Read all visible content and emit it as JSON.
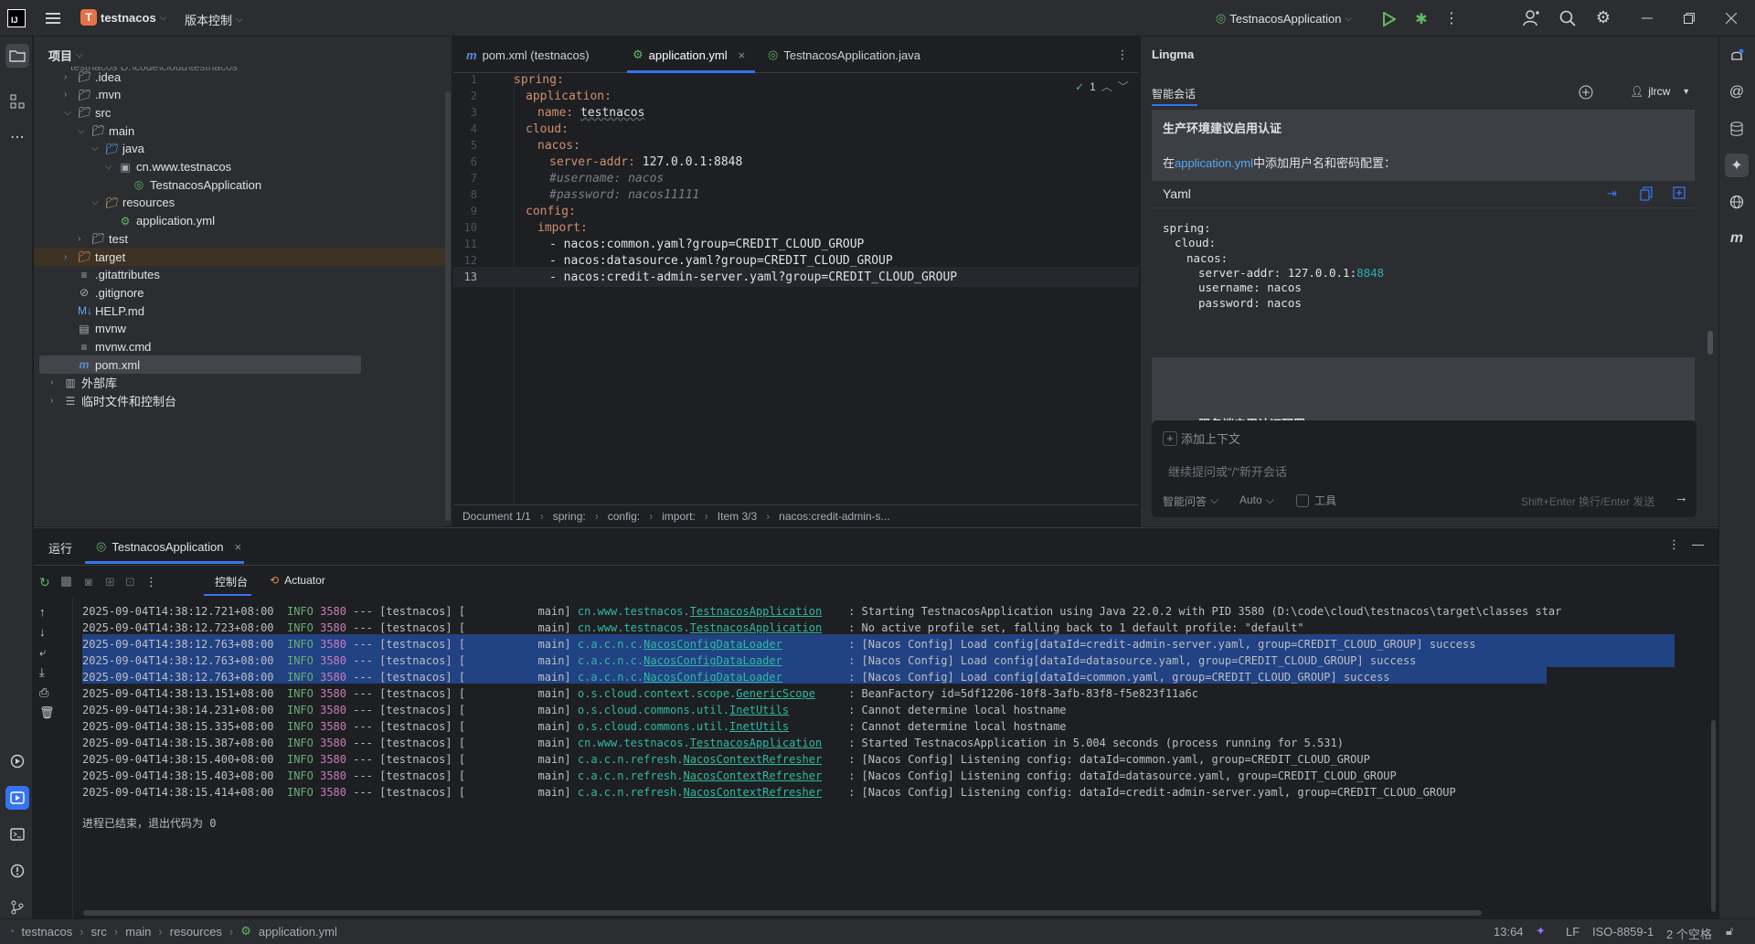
{
  "titlebar": {
    "project_initial": "T",
    "project_name": "testnacos",
    "vcs_menu": "版本控制",
    "run_config": "TestnacosApplication"
  },
  "project_panel": {
    "title": "项目",
    "tree": [
      {
        "label": ".idea",
        "indent": 1,
        "type": "folder",
        "expanded": false
      },
      {
        "label": ".mvn",
        "indent": 1,
        "type": "folder",
        "expanded": false
      },
      {
        "label": "src",
        "indent": 1,
        "type": "folder",
        "expanded": true
      },
      {
        "label": "main",
        "indent": 2,
        "type": "folder",
        "expanded": true
      },
      {
        "label": "java",
        "indent": 3,
        "type": "src-folder",
        "expanded": true
      },
      {
        "label": "cn.www.testnacos",
        "indent": 4,
        "type": "package",
        "expanded": true
      },
      {
        "label": "TestnacosApplication",
        "indent": 5,
        "type": "spring-class"
      },
      {
        "label": "resources",
        "indent": 3,
        "type": "res-folder",
        "expanded": true
      },
      {
        "label": "application.yml",
        "indent": 4,
        "type": "yml"
      },
      {
        "label": "test",
        "indent": 2,
        "type": "folder",
        "expanded": false
      },
      {
        "label": "target",
        "indent": 1,
        "type": "target-folder",
        "expanded": false
      },
      {
        "label": ".gitattributes",
        "indent": 1,
        "type": "file"
      },
      {
        "label": ".gitignore",
        "indent": 1,
        "type": "ignore"
      },
      {
        "label": "HELP.md",
        "indent": 1,
        "type": "md"
      },
      {
        "label": "mvnw",
        "indent": 1,
        "type": "script"
      },
      {
        "label": "mvnw.cmd",
        "indent": 1,
        "type": "file"
      },
      {
        "label": "pom.xml",
        "indent": 1,
        "type": "maven"
      },
      {
        "label": "外部库",
        "indent": 0,
        "type": "lib",
        "expanded": false
      },
      {
        "label": "临时文件和控制台",
        "indent": 0,
        "type": "scratch",
        "expanded": false
      }
    ]
  },
  "editor": {
    "tabs": [
      {
        "label": "pom.xml (testnacos)",
        "icon": "maven-icon",
        "active": false
      },
      {
        "label": "application.yml",
        "icon": "yml-icon",
        "active": true
      },
      {
        "label": "TestnacosApplication.java",
        "icon": "spring-class-icon",
        "active": false
      }
    ],
    "inspection_count": "1",
    "lines": [
      {
        "n": "1",
        "i": 0,
        "k": "spring:",
        "v": "",
        "c": ""
      },
      {
        "n": "2",
        "i": 1,
        "k": "application:",
        "v": "",
        "c": ""
      },
      {
        "n": "3",
        "i": 2,
        "k": "name: ",
        "v": "testnacos",
        "c": ""
      },
      {
        "n": "4",
        "i": 1,
        "k": "cloud:",
        "v": "",
        "c": ""
      },
      {
        "n": "5",
        "i": 2,
        "k": "nacos:",
        "v": "",
        "c": ""
      },
      {
        "n": "6",
        "i": 3,
        "k": "server-addr: ",
        "v": "127.0.0.1:8848",
        "c": ""
      },
      {
        "n": "7",
        "i": 3,
        "k": "",
        "v": "",
        "c": "#username: nacos"
      },
      {
        "n": "8",
        "i": 3,
        "k": "",
        "v": "",
        "c": "#password: nacos11111"
      },
      {
        "n": "9",
        "i": 1,
        "k": "config:",
        "v": "",
        "c": ""
      },
      {
        "n": "10",
        "i": 2,
        "k": "import:",
        "v": "",
        "c": ""
      },
      {
        "n": "11",
        "i": 3,
        "k": "",
        "v": "- nacos:common.yaml?group=CREDIT_CLOUD_GROUP",
        "c": ""
      },
      {
        "n": "12",
        "i": 3,
        "k": "",
        "v": "- nacos:datasource.yaml?group=CREDIT_CLOUD_GROUP",
        "c": ""
      },
      {
        "n": "13",
        "i": 3,
        "k": "",
        "v": "- nacos:credit-admin-server.yaml?group=CREDIT_CLOUD_GROUP",
        "c": ""
      }
    ],
    "breadcrumb": [
      "Document 1/1",
      "spring:",
      "config:",
      "import:",
      "Item 3/3",
      "nacos:credit-admin-s..."
    ]
  },
  "lingma": {
    "title": "Lingma",
    "tab": "智能会话",
    "user": "jlrcw",
    "heading1": "生产环境建议启用认证",
    "para_prefix": "在",
    "para_link": "application.yml",
    "para_suffix": "中添加用户名和密码配置：",
    "code_lang": "Yaml",
    "code": [
      {
        "i": 0,
        "k": "spring:",
        "v": ""
      },
      {
        "i": 1,
        "k": "cloud:",
        "v": ""
      },
      {
        "i": 2,
        "k": "nacos:",
        "v": ""
      },
      {
        "i": 3,
        "k": "server-addr: 127.0.0.1:",
        "v": "8848"
      },
      {
        "i": 3,
        "k": "username: nacos",
        "v": ""
      },
      {
        "i": 3,
        "k": "password: nacos",
        "v": ""
      }
    ],
    "heading2": "Nacos服务端启用认证配置",
    "add_context": "添加上下文",
    "input_placeholder": "继续提问或\"/\"新开会话",
    "mode": "智能问答",
    "model": "Auto",
    "tools": "工具",
    "send_hint": "Shift+Enter 换行/Enter 发送"
  },
  "run_panel": {
    "title": "运行",
    "tab": "TestnacosApplication",
    "console_tab": "控制台",
    "actuator_tab": "Actuator",
    "logs": [
      {
        "ts": "2025-09-04T14:38:12.721+08:00",
        "lvl": "INFO",
        "pid": "3580",
        "mid": " --- [testnacos] [           main] ",
        "pkg": "cn.www.testnacos.",
        "cls": "TestnacosApplication",
        "pad": "    ",
        "msg": ": Starting TestnacosApplication using Java 22.0.2 with PID 3580 (D:\\code\\cloud\\testnacos\\target\\classes star",
        "sel": false
      },
      {
        "ts": "2025-09-04T14:38:12.723+08:00",
        "lvl": "INFO",
        "pid": "3580",
        "mid": " --- [testnacos] [           main] ",
        "pkg": "cn.www.testnacos.",
        "cls": "TestnacosApplication",
        "pad": "    ",
        "msg": ": No active profile set, falling back to 1 default profile: \"default\"",
        "sel": false
      },
      {
        "ts": "2025-09-04T14:38:12.763+08:00",
        "lvl": "INFO",
        "pid": "3580",
        "mid": " --- [testnacos] [           main] ",
        "pkg": "c.a.c.n.c.",
        "cls": "NacosConfigDataLoader",
        "pad": "          ",
        "msg": ": [Nacos Config] Load config[dataId=credit-admin-server.yaml, group=CREDIT_CLOUD_GROUP] success",
        "sel": true
      },
      {
        "ts": "2025-09-04T14:38:12.763+08:00",
        "lvl": "INFO",
        "pid": "3580",
        "mid": " --- [testnacos] [           main] ",
        "pkg": "c.a.c.n.c.",
        "cls": "NacosConfigDataLoader",
        "pad": "          ",
        "msg": ": [Nacos Config] Load config[dataId=datasource.yaml, group=CREDIT_CLOUD_GROUP] success",
        "sel": true
      },
      {
        "ts": "2025-09-04T14:38:12.763+08:00",
        "lvl": "INFO",
        "pid": "3580",
        "mid": " --- [testnacos] [           main] ",
        "pkg": "c.a.c.n.c.",
        "cls": "NacosConfigDataLoader",
        "pad": "          ",
        "msg": ": [Nacos Config] Load config[dataId=common.yaml, group=CREDIT_CLOUD_GROUP] success",
        "sel": true
      },
      {
        "ts": "2025-09-04T14:38:13.151+08:00",
        "lvl": "INFO",
        "pid": "3580",
        "mid": " --- [testnacos] [           main] ",
        "pkg": "o.s.cloud.context.scope.",
        "cls": "GenericScope",
        "pad": "     ",
        "msg": ": BeanFactory id=5df12206-10f8-3afb-83f8-f5e823f11a6c",
        "sel": false
      },
      {
        "ts": "2025-09-04T14:38:14.231+08:00",
        "lvl": "INFO",
        "pid": "3580",
        "mid": " --- [testnacos] [           main] ",
        "pkg": "o.s.cloud.commons.util.",
        "cls": "InetUtils",
        "pad": "         ",
        "msg": ": Cannot determine local hostname",
        "sel": false
      },
      {
        "ts": "2025-09-04T14:38:15.335+08:00",
        "lvl": "INFO",
        "pid": "3580",
        "mid": " --- [testnacos] [           main] ",
        "pkg": "o.s.cloud.commons.util.",
        "cls": "InetUtils",
        "pad": "         ",
        "msg": ": Cannot determine local hostname",
        "sel": false
      },
      {
        "ts": "2025-09-04T14:38:15.387+08:00",
        "lvl": "INFO",
        "pid": "3580",
        "mid": " --- [testnacos] [           main] ",
        "pkg": "cn.www.testnacos.",
        "cls": "TestnacosApplication",
        "pad": "    ",
        "msg": ": Started TestnacosApplication in 5.004 seconds (process running for 5.531)",
        "sel": false
      },
      {
        "ts": "2025-09-04T14:38:15.400+08:00",
        "lvl": "INFO",
        "pid": "3580",
        "mid": " --- [testnacos] [           main] ",
        "pkg": "c.a.c.n.refresh.",
        "cls": "NacosContextRefresher",
        "pad": "    ",
        "msg": ": [Nacos Config] Listening config: dataId=common.yaml, group=CREDIT_CLOUD_GROUP",
        "sel": false
      },
      {
        "ts": "2025-09-04T14:38:15.403+08:00",
        "lvl": "INFO",
        "pid": "3580",
        "mid": " --- [testnacos] [           main] ",
        "pkg": "c.a.c.n.refresh.",
        "cls": "NacosContextRefresher",
        "pad": "    ",
        "msg": ": [Nacos Config] Listening config: dataId=datasource.yaml, group=CREDIT_CLOUD_GROUP",
        "sel": false
      },
      {
        "ts": "2025-09-04T14:38:15.414+08:00",
        "lvl": "INFO",
        "pid": "3580",
        "mid": " --- [testnacos] [           main] ",
        "pkg": "c.a.c.n.refresh.",
        "cls": "NacosContextRefresher",
        "pad": "    ",
        "msg": ": [Nacos Config] Listening config: dataId=credit-admin-server.yaml, group=CREDIT_CLOUD_GROUP",
        "sel": false
      }
    ],
    "exit_message": "进程已结束，退出代码为 0"
  },
  "statusbar": {
    "path": [
      "testnacos",
      "src",
      "main",
      "resources",
      "application.yml"
    ],
    "cursor": "13:64",
    "line_sep": "LF",
    "encoding": "ISO-8859-1",
    "indent": "2 个空格"
  },
  "colors": {
    "accent": "#3574f0",
    "selection": "#214283",
    "run_green": "#5fb865"
  }
}
